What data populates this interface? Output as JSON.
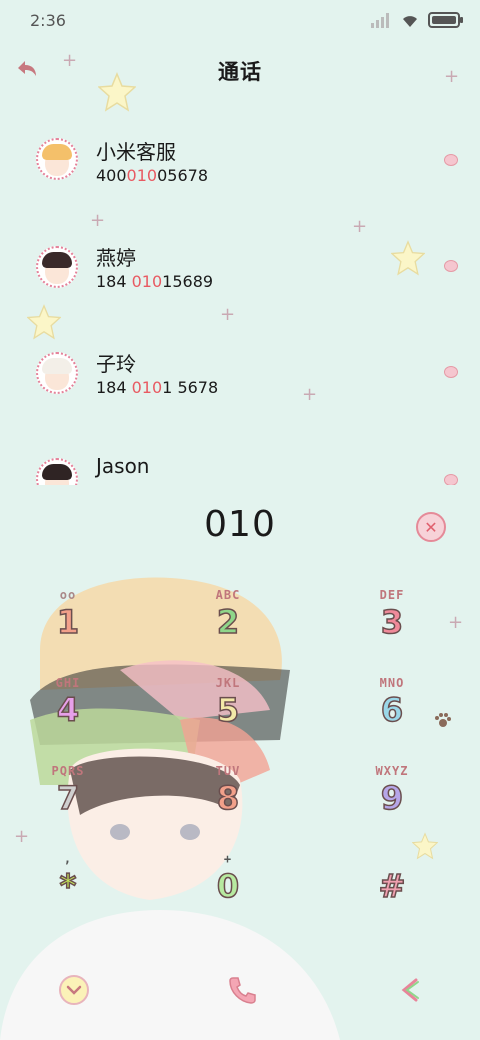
{
  "status_bar": {
    "time": "2:36"
  },
  "header": {
    "title": "通话"
  },
  "calls": [
    {
      "name": "小米客服",
      "pre": "400",
      "match": "010",
      "post": "05678"
    },
    {
      "name": "燕婷",
      "pre": "184 ",
      "match": "010",
      "post": "15689"
    },
    {
      "name": "子玲",
      "pre": "184 ",
      "match": "010",
      "post": "1 5678"
    },
    {
      "name": "Jason",
      "pre": "",
      "match": "",
      "post": ""
    }
  ],
  "dialer": {
    "digits": "010"
  },
  "keypad": [
    {
      "letters": "oo",
      "digit": "1"
    },
    {
      "letters": "ABC",
      "digit": "2"
    },
    {
      "letters": "DEF",
      "digit": "3"
    },
    {
      "letters": "GHI",
      "digit": "4"
    },
    {
      "letters": "JKL",
      "digit": "5"
    },
    {
      "letters": "MNO",
      "digit": "6"
    },
    {
      "letters": "PQRS",
      "digit": "7"
    },
    {
      "letters": "TUV",
      "digit": "8"
    },
    {
      "letters": "WXYZ",
      "digit": "9"
    },
    {
      "letters": ",",
      "digit": "*"
    },
    {
      "letters": "+",
      "digit": "0"
    },
    {
      "letters": "",
      "digit": "#"
    }
  ],
  "colors": {
    "background": "#e3f3ee",
    "highlight": "#e85a62",
    "key_1": "#f2a08a",
    "key_2": "#8fd68a",
    "key_3": "#f08a9a",
    "key_4": "#e7a0ea",
    "key_5": "#f3e9a8",
    "key_6": "#9ad7e8",
    "key_7": "#cfcfcf",
    "key_8": "#f2a08a",
    "key_9": "#b6a6e8",
    "key_star": "#c5e85a",
    "key_0": "#b7eaa0",
    "key_hash": "#f0a0b0"
  },
  "icons": {
    "back": "back-arrow-icon",
    "delete": "delete-circle-icon",
    "collapse": "chevron-down-icon",
    "call": "phone-icon",
    "switch": "chevron-left-icon"
  }
}
